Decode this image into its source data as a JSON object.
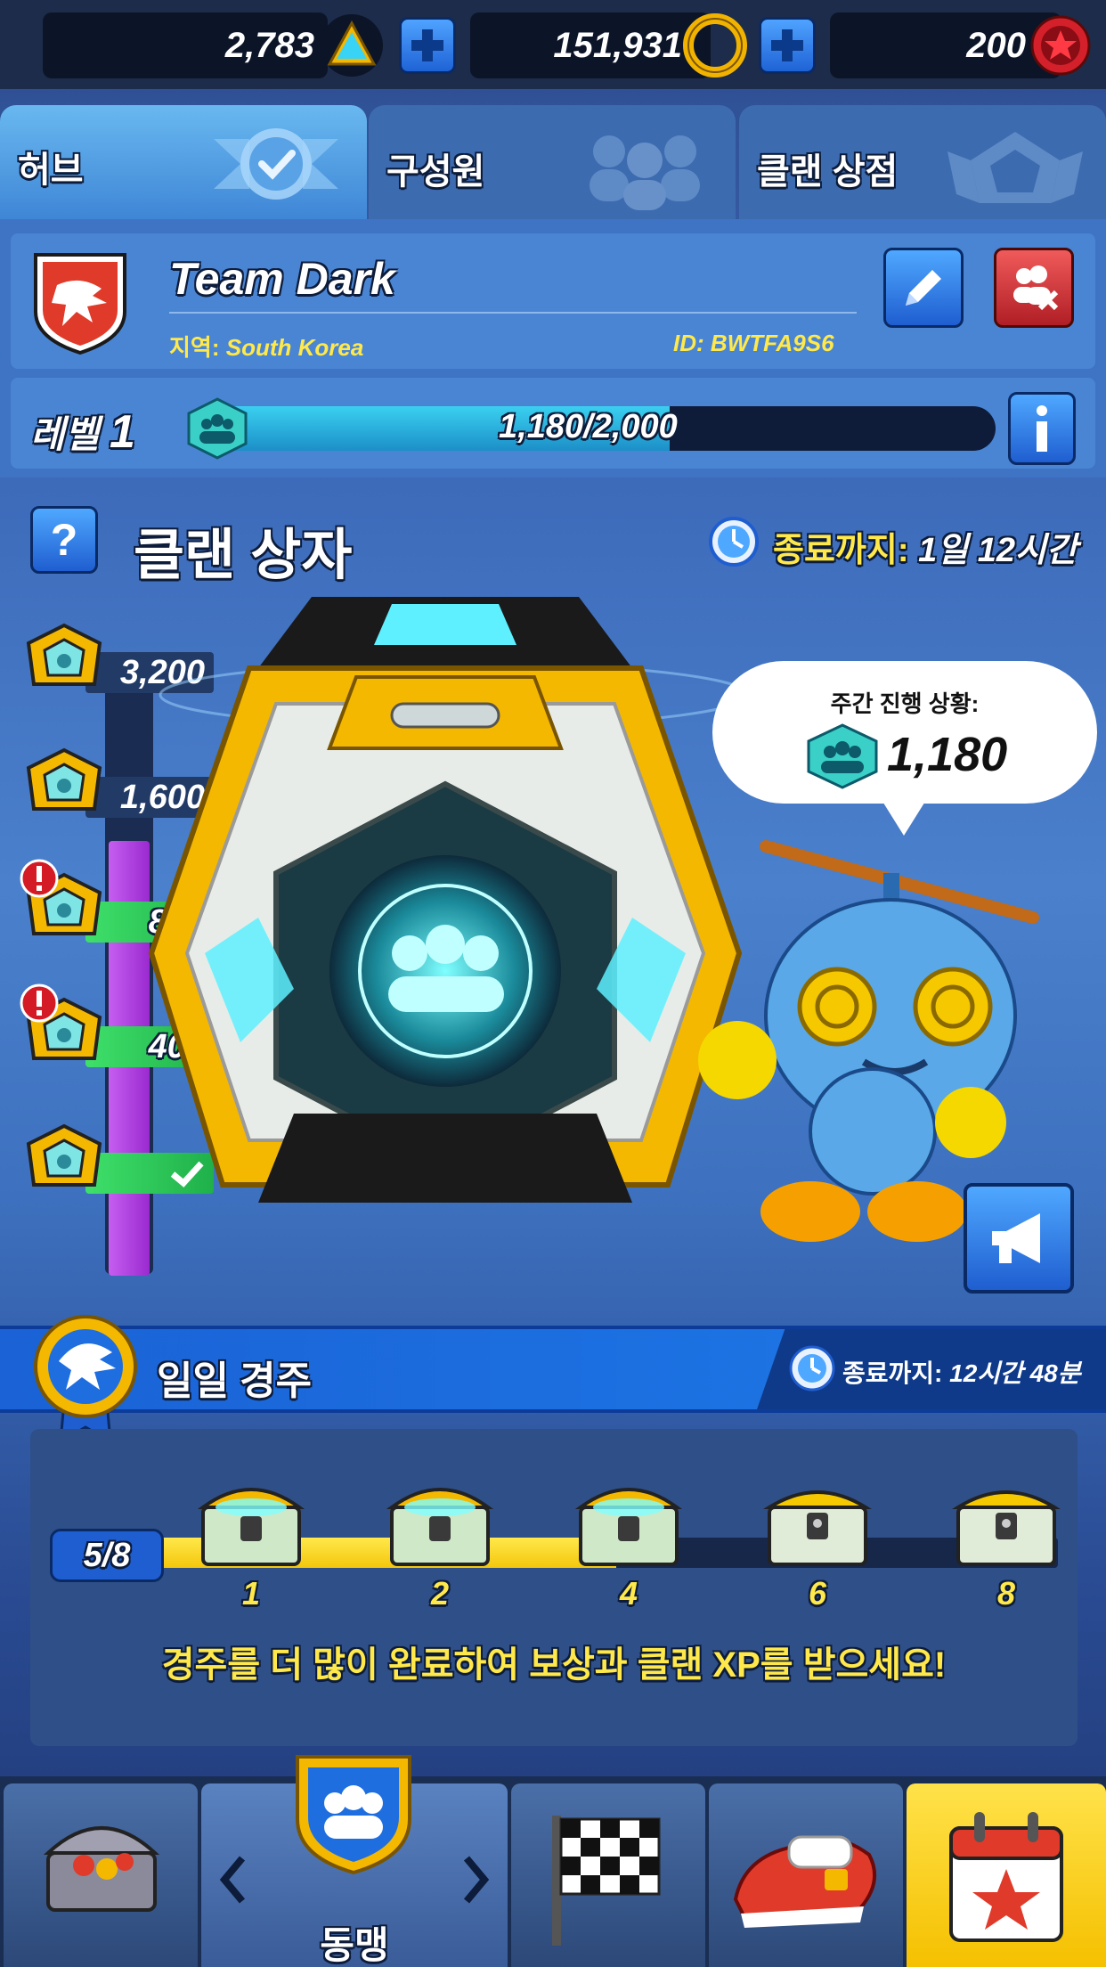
{
  "currencies": {
    "gems": "2,783",
    "rings": "151,931",
    "red_rings": "200"
  },
  "tabs": [
    {
      "label": "허브",
      "active": true
    },
    {
      "label": "구성원",
      "active": false
    },
    {
      "label": "클랜 상점",
      "active": false
    }
  ],
  "clan": {
    "name": "Team Dark",
    "region_label": "지역:",
    "region_value": "South Korea",
    "id_text": "ID: BWTFA9S6",
    "level_label": "레벨",
    "level_value": "1",
    "xp_text": "1,180/2,000",
    "xp_fraction": 0.59
  },
  "clan_chest": {
    "title": "클랜 상자",
    "ends_label": "종료까지:",
    "ends_value": "1일 12시간",
    "tiers": [
      {
        "value": "3,200",
        "reached": false,
        "alert": false
      },
      {
        "value": "1,600",
        "reached": false,
        "alert": false
      },
      {
        "value": "800",
        "reached": true,
        "alert": true
      },
      {
        "value": "400",
        "reached": true,
        "alert": true
      },
      {
        "value": "",
        "reached": true,
        "claimed": true,
        "alert": false
      }
    ],
    "weekly_progress_label": "주간 진행 상황:",
    "weekly_progress_value": "1,180",
    "help_glyph": "?"
  },
  "daily_race": {
    "title": "일일 경주",
    "ends_label": "종료까지:",
    "ends_value": "12시간 48분",
    "progress_text": "5/8",
    "progress_fraction": 0.51,
    "milestones": [
      "1",
      "2",
      "4",
      "6",
      "8"
    ],
    "message": "경주를 더 많이 완료하여 보상과 클랜 XP를 받으세요!"
  },
  "bottom_nav": {
    "active_label": "동맹",
    "items": [
      "chest-icon",
      "clan-shield-icon",
      "checkered-flag-icon",
      "shoes-icon",
      "calendar-icon"
    ]
  },
  "colors": {
    "accent_blue": "#1f63d6",
    "gold": "#ffe94a",
    "green": "#3fe06a",
    "purple": "#b84ce0",
    "teal": "#3ad0f0"
  }
}
